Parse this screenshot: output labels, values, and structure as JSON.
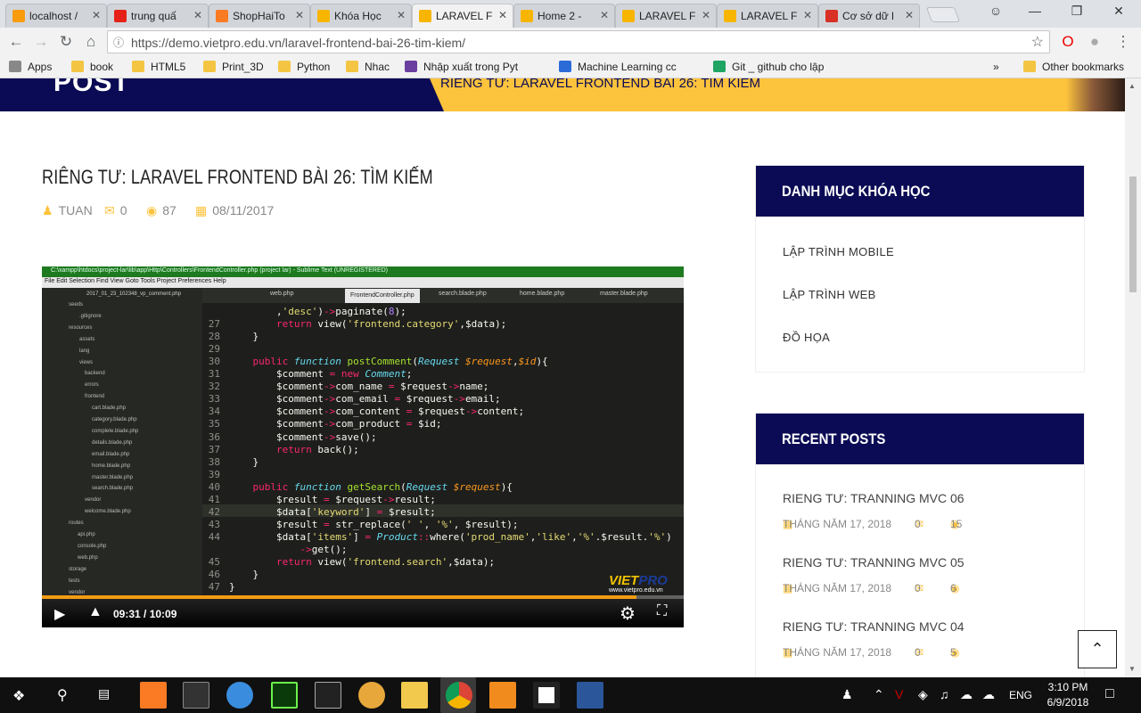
{
  "browser": {
    "tabs": [
      {
        "title": "localhost /",
        "icon": "phpmyadmin-icon",
        "color": "#f89c0e"
      },
      {
        "title": "trung quấ",
        "icon": "youtube-icon",
        "color": "#e62117"
      },
      {
        "title": "ShopHaiTo",
        "icon": "xampp-icon",
        "color": "#fb7a24"
      },
      {
        "title": "Khóa Học",
        "icon": "vietpro-icon",
        "color": "#f7b500"
      },
      {
        "title": "LARAVEL F",
        "icon": "vietpro-icon",
        "color": "#f7b500"
      },
      {
        "title": "Home 2 -",
        "icon": "vietpro-icon",
        "color": "#f7b500"
      },
      {
        "title": "LARAVEL F",
        "icon": "vietpro-icon",
        "color": "#f7b500"
      },
      {
        "title": "LARAVEL F",
        "icon": "vietpro-icon",
        "color": "#f7b500"
      },
      {
        "title": "Cơ sở dữ l",
        "icon": "database-icon",
        "color": "#d93025"
      }
    ],
    "active_tab": 4,
    "url": "https://demo.vietpro.edu.vn/laravel-frontend-bai-26-tim-kiem/",
    "bookmarks": [
      {
        "label": "Apps",
        "icon": "apps-icon"
      },
      {
        "label": "book",
        "icon": "folder-icon"
      },
      {
        "label": "HTML5",
        "icon": "folder-icon"
      },
      {
        "label": "Print_3D",
        "icon": "folder-icon"
      },
      {
        "label": "Python",
        "icon": "folder-icon"
      },
      {
        "label": "Nhac",
        "icon": "folder-icon"
      },
      {
        "label": "Nhập xuất trong Pyt",
        "icon": "coursera-icon"
      },
      {
        "label": "Machine Learning cc",
        "icon": "ml-icon"
      },
      {
        "label": "Git _ github cho lập",
        "icon": "drive-icon"
      },
      {
        "label": "»",
        "icon": ""
      },
      {
        "label": "Other bookmarks",
        "icon": "folder-icon"
      }
    ]
  },
  "banner": {
    "post_text": "POST",
    "breadcrumb": "RIÊNG TƯ: LARAVEL FRONTEND BÀI 26: TÌM KIẾM"
  },
  "post": {
    "title": "RIÊNG TƯ: LARAVEL FRONTEND BÀI 26: TÌM KIẾM",
    "author": "TUAN",
    "comments": "0",
    "views": "87",
    "date": "08/11/2017"
  },
  "video": {
    "window_title": "C:\\xampp\\htdocs\\project-lar\\lib\\app\\Http\\Controllers\\FrontendController.php (project lar) - Sublime Text (UNREGISTERED)",
    "menu": "File  Edit  Selection  Find  View  Goto  Tools  Project  Preferences  Help",
    "editor_tabs": [
      "web.php",
      "FrontendController.php",
      "search.blade.php",
      "home.blade.php",
      "master.blade.php"
    ],
    "sidebar_top": "2017_01_23_102348_vp_comment.php",
    "sidebar_files": [
      "seeds",
      ".gitignore",
      "resources",
      "assets",
      "lang",
      "views",
      "backend",
      "errors",
      "frontend",
      "cart.blade.php",
      "category.blade.php",
      "complete.blade.php",
      "details.blade.php",
      "email.blade.php",
      "home.blade.php",
      "master.blade.php",
      "search.blade.php",
      "vendor",
      "welcome.blade.php",
      "routes",
      "api.php",
      "console.php",
      "web.php",
      "storage",
      "tests",
      "vendor"
    ],
    "time": "09:31 / 10:09",
    "progress": 0.927,
    "logo_main": "VIET",
    "logo_accent": "PRO",
    "logo_url": "www.vietpro.edu.vn"
  },
  "sidebar": {
    "categories_title": "DANH MỤC KHÓA HỌC",
    "categories": [
      "LẬP TRÌNH MOBILE",
      "LẬP TRÌNH WEB",
      "ĐỒ HỌA"
    ],
    "recent_title": "RECENT POSTS",
    "recent": [
      {
        "title": "RIENG TƯ: TRANNING MVC 06",
        "date": "THÁNG NĂM 17, 2018",
        "comments": "0",
        "views": "15"
      },
      {
        "title": "RIENG TƯ: TRANNING MVC 05",
        "date": "THÁNG NĂM 17, 2018",
        "comments": "0",
        "views": "6"
      },
      {
        "title": "RIENG TƯ: TRANNING MVC 04",
        "date": "THÁNG NĂM 17, 2018",
        "comments": "0",
        "views": "5"
      }
    ]
  },
  "taskbar": {
    "lang": "ENG",
    "time": "3:10 PM",
    "date": "6/9/2018"
  }
}
